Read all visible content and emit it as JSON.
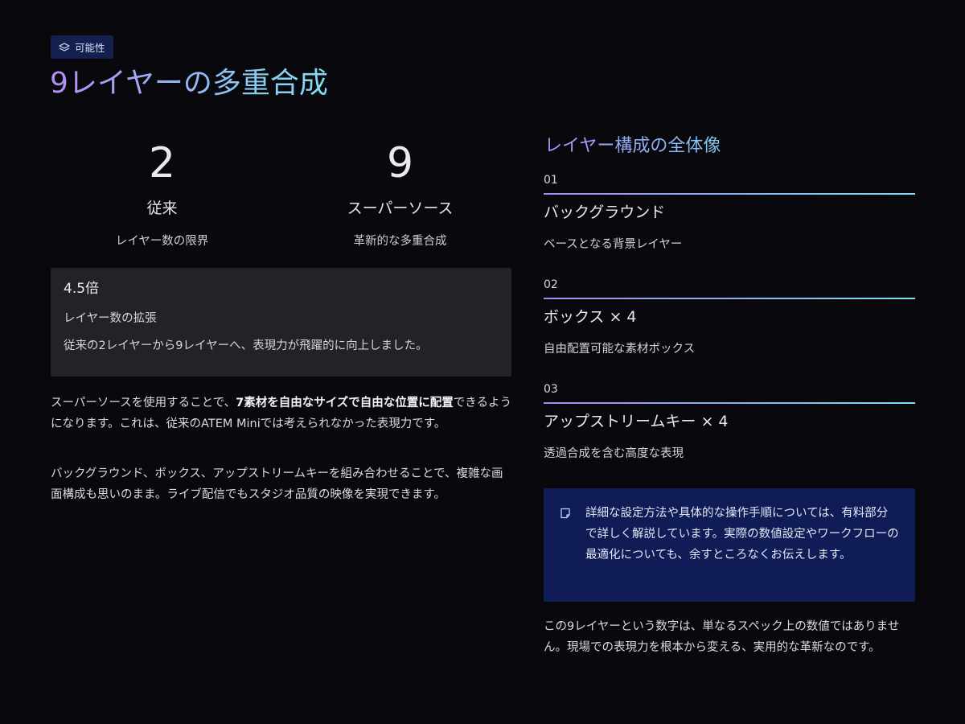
{
  "header": {
    "badge_label": "可能性",
    "badge_icon": "layers-icon",
    "title": "9レイヤーの多重合成"
  },
  "stats": [
    {
      "number": "2",
      "label": "従来",
      "sub": "レイヤー数の限界"
    },
    {
      "number": "9",
      "label": "スーパーソース",
      "sub": "革新的な多重合成"
    }
  ],
  "highlight": {
    "title": "4.5倍",
    "sub": "レイヤー数の拡張",
    "description": "従来の2レイヤーから9レイヤーへ、表現力が飛躍的に向上しました。"
  },
  "paragraphs": {
    "p1_before": "スーパーソースを使用することで、",
    "p1_bold": "7素材を自由なサイズで自由な位置に配置",
    "p1_after": "できるようになります。これは、従来のATEM Miniでは考えられなかった表現力です。",
    "p2": "バックグラウンド、ボックス、アップストリームキーを組み合わせることで、複雑な画面構成も思いのまま。ライブ配信でもスタジオ品質の映像を実現できます。"
  },
  "structure": {
    "title": "レイヤー構成の全体像",
    "layers": [
      {
        "num": "01",
        "name": "バックグラウンド",
        "desc": "ベースとなる背景レイヤー"
      },
      {
        "num": "02",
        "name": "ボックス × 4",
        "desc": "自由配置可能な素材ボックス"
      },
      {
        "num": "03",
        "name": "アップストリームキー × 4",
        "desc": "透過合成を含む高度な表現"
      }
    ]
  },
  "note": {
    "icon": "note-icon",
    "text": "詳細な設定方法や具体的な操作手順については、有料部分で詳しく解説しています。実際の数値設定やワークフローの最適化についても、余すところなくお伝えします。"
  },
  "closing": "この9レイヤーという数字は、単なるスペック上の数値ではありません。現場での表現力を根本から変える、実用的な革新なのです。",
  "colors": {
    "background": "#09080d",
    "badge_bg": "#14204f",
    "card_bg": "#232228",
    "note_bg": "#0f1c55",
    "accent_purple": "#b48ef4",
    "accent_cyan": "#7ee0f2"
  }
}
